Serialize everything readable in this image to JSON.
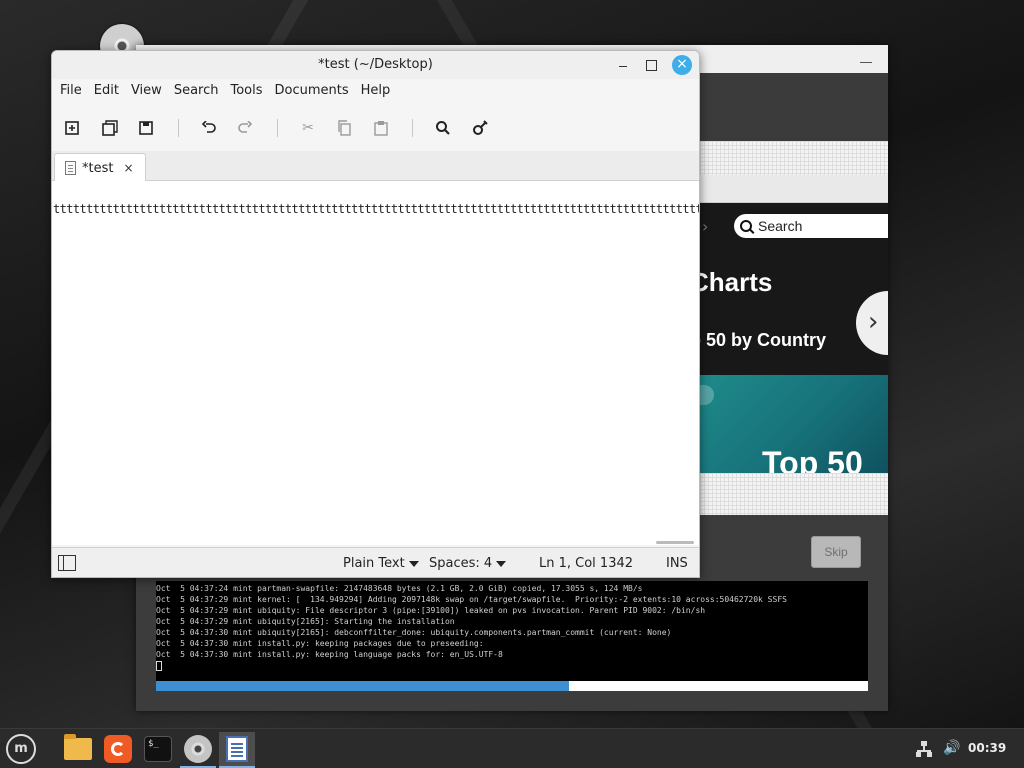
{
  "editor": {
    "title": "*test (~/Desktop)",
    "menu": [
      "File",
      "Edit",
      "View",
      "Search",
      "Tools",
      "Documents",
      "Help"
    ],
    "toolbar_icons": [
      "new-document-icon",
      "open-icon",
      "save-icon",
      "undo-icon",
      "redo-icon",
      "cut-icon",
      "copy-icon",
      "paste-icon",
      "search-icon",
      "replace-icon"
    ],
    "tab_label": "*test",
    "tab_close": "×",
    "content": "tttttttttttttttttttttttttttttttttttttttttttttttttttttttttttttttttttttttttttttttttttttttttttttttttttttttttttttttttttttttttttttttttttttttttttttttttt",
    "status": {
      "syntax": "Plain Text",
      "indent": "Spaces: 4",
      "position": "Ln 1, Col 1342",
      "mode": "INS"
    }
  },
  "installer": {
    "web": {
      "search_placeholder": "Search",
      "heading": "Charts",
      "subheading": "p 50 by Country",
      "cover_text": "Top 50"
    },
    "skip_label": "Skip",
    "log_lines": [
      "Oct  5 04:37:24 mint partman-swapfile: 2147483648 bytes (2.1 GB, 2.0 GiB) copied, 17.3055 s, 124 MB/s",
      "Oct  5 04:37:29 mint kernel: [  134.949294] Adding 2097148k swap on /target/swapfile.  Priority:-2 extents:10 across:50462720k SSFS",
      "Oct  5 04:37:29 mint ubiquity: File descriptor 3 (pipe:[39100]) leaked on pvs invocation. Parent PID 9002: /bin/sh",
      "Oct  5 04:37:29 mint ubiquity[2165]: Starting the installation",
      "Oct  5 04:37:30 mint ubiquity[2165]: debconffilter_done: ubiquity.components.partman_commit (current: None)",
      "Oct  5 04:37:30 mint install.py: keeping packages due to preseeding:",
      "Oct  5 04:37:30 mint install.py: keeping language packs for: en_US.UTF-8"
    ],
    "progress_fraction": 0.58
  },
  "taskbar": {
    "apps": [
      "menu-icon",
      "files-icon",
      "firefox-icon",
      "terminal-icon",
      "dvd-icon",
      "text-editor-icon"
    ],
    "clock": "00:39",
    "terminal_glyph": "$_"
  },
  "colors": {
    "accent": "#3daee9",
    "progress": "#3d8fd1",
    "spotify_teal": "#1f8a8a"
  }
}
